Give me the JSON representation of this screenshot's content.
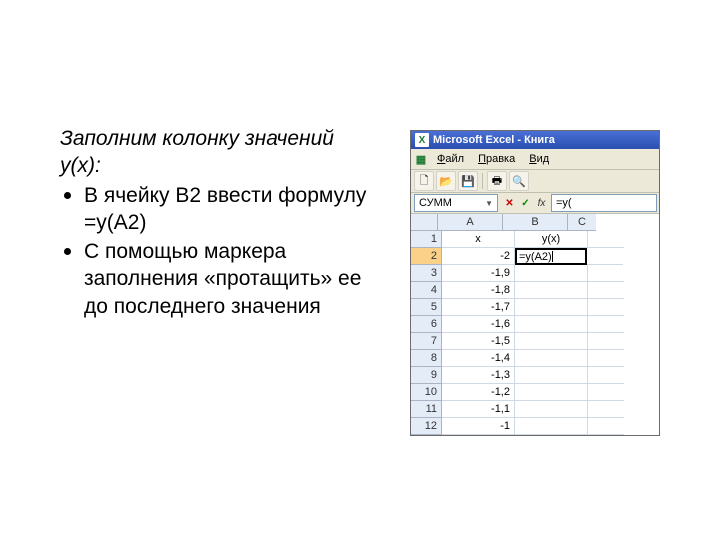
{
  "text": {
    "intro": "Заполним колонку значений y(x):",
    "item1_line1": "В ячейку B2 ввести формулу",
    "item1_line2": "=y(A2)",
    "item2": "С помощью маркера заполнения «протащить» ее до последнего значения"
  },
  "excel": {
    "title": "Microsoft Excel - Книга",
    "menu": {
      "file": "Файл",
      "edit": "Правка",
      "view": "Вид"
    },
    "namebox": "СУММ",
    "formula_bar": "=y(",
    "columns": {
      "A": "A",
      "B": "B",
      "C": "C"
    },
    "header_row": {
      "A": "x",
      "B": "y(x)"
    },
    "editing_cell_text": "=y(A2)",
    "rows": [
      {
        "n": "1",
        "A": "x",
        "B": "y(x)"
      },
      {
        "n": "2",
        "A": "-2",
        "B": "=y(A2)"
      },
      {
        "n": "3",
        "A": "-1,9",
        "B": ""
      },
      {
        "n": "4",
        "A": "-1,8",
        "B": ""
      },
      {
        "n": "5",
        "A": "-1,7",
        "B": ""
      },
      {
        "n": "6",
        "A": "-1,6",
        "B": ""
      },
      {
        "n": "7",
        "A": "-1,5",
        "B": ""
      },
      {
        "n": "8",
        "A": "-1,4",
        "B": ""
      },
      {
        "n": "9",
        "A": "-1,3",
        "B": ""
      },
      {
        "n": "10",
        "A": "-1,2",
        "B": ""
      },
      {
        "n": "11",
        "A": "-1,1",
        "B": ""
      },
      {
        "n": "12",
        "A": "-1",
        "B": ""
      }
    ]
  }
}
